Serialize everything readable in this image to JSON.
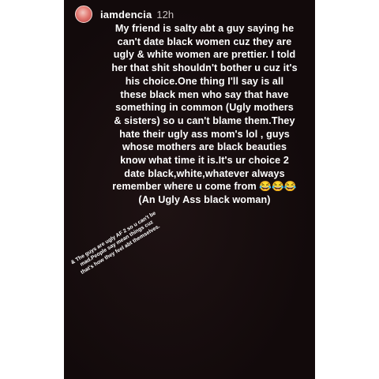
{
  "story": {
    "username": "iamdencia",
    "timestamp": "12h",
    "main_text": "My friend is salty abt a guy saying he can't date black women cuz they are ugly & white women are prettier. I told her that shit shouldn't bother u cuz it's his choice.One thing I'll say is all these black men who say that have something in common (Ugly mothers & sisters) so u can't blame them.They hate their ugly ass mom's lol , guys whose mothers are black beauties know what time it is.It's ur choice 2 date black,white,whatever always remember where u come from 😂😂😂 (An Ugly Ass black woman)",
    "side_note": "& The guys are ugly AF 2 so u can't be mad.People say mean things cuz that's how they feel abt themselves."
  },
  "colors": {
    "story_background": "#120a0b",
    "text": "#ffffff",
    "timestamp": "#c9c3c3",
    "page_background": "#ffffff"
  },
  "icons": {
    "avatar": "profile-avatar"
  }
}
